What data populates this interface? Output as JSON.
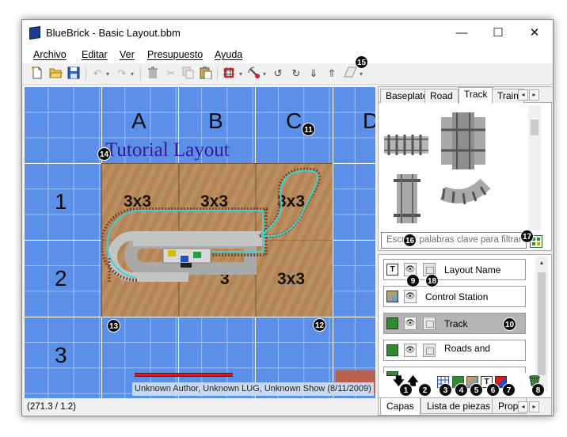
{
  "window": {
    "title": "BlueBrick - Basic Layout.bbm",
    "controls": {
      "minimize": "—",
      "maximize": "☐",
      "close": "✕"
    }
  },
  "menu": [
    "Archivo",
    "Editar",
    "Ver",
    "Presupuesto",
    "Ayuda"
  ],
  "toolbar": {
    "icons": [
      "new-file-icon",
      "open-folder-icon",
      "save-icon",
      "undo-icon",
      "redo-icon",
      "delete-icon",
      "cut-icon",
      "copy-icon",
      "paste-icon",
      "snap-grid-icon",
      "paint-icon",
      "rotate-left-icon",
      "rotate-right-icon",
      "send-to-back-icon",
      "bring-to-front-icon",
      "eraser-icon"
    ]
  },
  "map": {
    "column_labels": [
      "A",
      "B",
      "C",
      "D"
    ],
    "row_labels": [
      "1",
      "2",
      "3"
    ],
    "layout_title": "Tutorial Layout",
    "tiles": [
      "3x3",
      "3x3",
      "3x3",
      "3",
      "3x3"
    ],
    "credits": "Unknown Author, Unknown LUG, Unknown Show (8/11/2009)"
  },
  "status": {
    "coordinates": "(271.3 / 1.2)"
  },
  "parts_panel": {
    "tabs": [
      "Baseplate",
      "Road",
      "Track",
      "Train"
    ],
    "active_tab": "Track",
    "filter_placeholder": "Escribir palabras clave para filtrar aquí"
  },
  "layers_panel": {
    "layers": [
      {
        "name": "Layout Name",
        "type": "text"
      },
      {
        "name": "Control Station",
        "type": "area"
      },
      {
        "name": "Track",
        "type": "brick",
        "selected": true
      },
      {
        "name": "Roads and",
        "type": "brick"
      },
      {
        "name": "",
        "type": "brick"
      }
    ],
    "bottom_tabs": [
      "Capas",
      "Lista de piezas",
      "Propi"
    ],
    "active_bottom_tab": "Capas"
  },
  "callouts": [
    "1",
    "2",
    "3",
    "4",
    "5",
    "6",
    "7",
    "8",
    "9",
    "10",
    "11",
    "12",
    "13",
    "14",
    "15",
    "16",
    "17",
    "18"
  ],
  "colors": {
    "grid_blue": "#5b8fe8",
    "board_wood": "#b8895a",
    "selected_layer": "#b4b4b4",
    "track_path": "#3ad3d3"
  }
}
